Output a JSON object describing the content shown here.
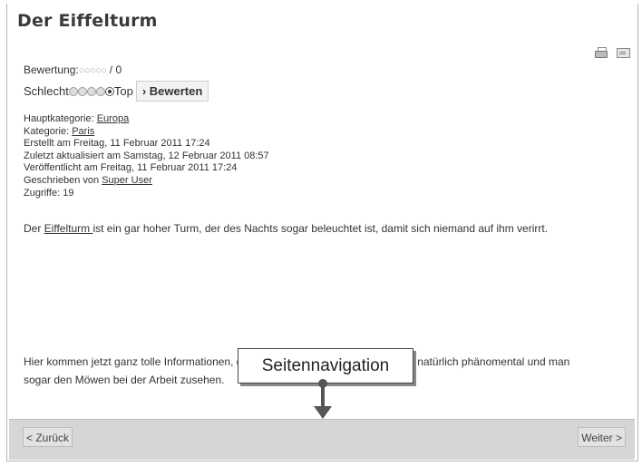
{
  "article": {
    "title": "Der Eiffelturm",
    "rating_label": "Bewertung:",
    "rating_circles": "○○○○○",
    "rating_value": " / 0",
    "vote_low": "Schlecht",
    "vote_high": "Top",
    "vote_button": "› Bewerten",
    "meta": {
      "main_category_label": "Hauptkategorie: ",
      "main_category_link": "Europa",
      "category_label": "Kategorie: ",
      "category_link": "Paris",
      "created": "Erstellt am Freitag, 11 Februar 2011 17:24",
      "updated": "Zuletzt aktualisiert am Samstag, 12 Februar 2011 08:57",
      "published": "Veröffentlicht am Freitag, 11 Februar 2011 17:24",
      "author_label": "Geschrieben von ",
      "author_link": "Super User",
      "hits": "Zugriffe: 19"
    },
    "body_prefix": "Der ",
    "body_link": "Eiffelturm ",
    "body_suffix": "ist ein gar hoher Turm, der des Nachts sogar beleuchtet ist, damit sich niemand auf ihm verirrt.",
    "info_text": "Hier kommen jetzt ganz tolle Informationen, die wir hier angeben. Die Aussicht ist natürlich phänomental und man sogar den Möwen bei der Arbeit zusehen."
  },
  "icons": {
    "print": "print-icon",
    "email": "mail-icon"
  },
  "pagenav": {
    "prev_label": "< Zurück",
    "next_label": "Weiter >"
  },
  "callout": {
    "label": "Seitennavigation"
  }
}
